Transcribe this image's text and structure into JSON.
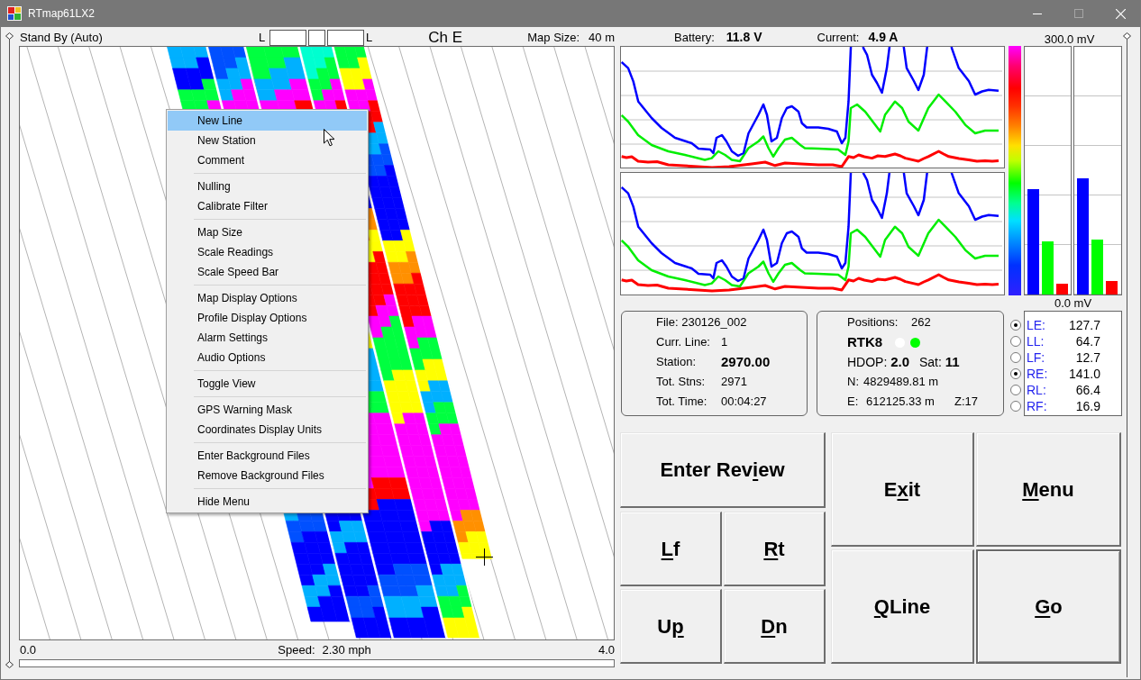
{
  "window": {
    "title": "RTmap61LX2",
    "maximize_enabled": false
  },
  "map_header": {
    "mode": "Stand By (Auto)",
    "left_marker": "L",
    "indicator_boxes": [
      {
        "kind": "wide"
      },
      {
        "kind": "narrow"
      },
      {
        "kind": "wide"
      }
    ],
    "right_marker": "L",
    "channel": "Ch E",
    "map_size_label": "Map Size:",
    "map_size": "40 m"
  },
  "context_menu": {
    "groups": [
      {
        "items": [
          {
            "label": "New Line",
            "selected": true
          },
          {
            "label": "New Station",
            "selected": false
          },
          {
            "label": "Comment",
            "selected": false
          }
        ]
      },
      {
        "items": [
          {
            "label": "Nulling",
            "selected": false
          },
          {
            "label": "Calibrate Filter",
            "selected": false
          }
        ]
      },
      {
        "items": [
          {
            "label": "Map Size",
            "selected": false
          },
          {
            "label": "Scale Readings",
            "selected": false
          },
          {
            "label": "Scale Speed Bar",
            "selected": false
          }
        ]
      },
      {
        "items": [
          {
            "label": "Map Display Options",
            "selected": false
          },
          {
            "label": "Profile Display Options",
            "selected": false
          },
          {
            "label": "Alarm Settings",
            "selected": false
          },
          {
            "label": "Audio Options",
            "selected": false
          }
        ]
      },
      {
        "items": [
          {
            "label": "Toggle View",
            "selected": false
          }
        ]
      },
      {
        "items": [
          {
            "label": "GPS Warning Mask",
            "selected": false
          },
          {
            "label": "Coordinates Display Units",
            "selected": false
          }
        ]
      },
      {
        "items": [
          {
            "label": "Enter Background Files",
            "selected": false
          },
          {
            "label": "Remove Background Files",
            "selected": false
          }
        ]
      },
      {
        "items": [
          {
            "label": "Hide Menu",
            "selected": false
          }
        ]
      }
    ]
  },
  "speed": {
    "min": "0.0",
    "label": "Speed:",
    "value": "2.30 mph",
    "max": "4.0"
  },
  "power": {
    "battery_label": "Battery:",
    "battery": "11.8 V",
    "current_label": "Current:",
    "current": "4.9 A"
  },
  "meters": {
    "max_label": "300.0 mV",
    "min_label": "0.0 mV",
    "groups": [
      {
        "bars": [
          {
            "level": 0.426,
            "color": "#0000ff"
          },
          {
            "level": 0.216,
            "color": "#00ff00"
          },
          {
            "level": 0.042,
            "color": "#ff0000"
          }
        ]
      },
      {
        "bars": [
          {
            "level": 0.47,
            "color": "#0000ff"
          },
          {
            "level": 0.221,
            "color": "#00ff00"
          },
          {
            "level": 0.056,
            "color": "#ff0000"
          }
        ]
      }
    ]
  },
  "file_panel": {
    "rows": [
      {
        "label": "File: 230126_002",
        "bold": false
      },
      {
        "label": "Curr. Line:",
        "value": "1",
        "bold": false
      },
      {
        "label": "Station:",
        "value": "2970.00",
        "bold": true
      },
      {
        "label": "Tot. Stns:",
        "value": "2971",
        "bold": false
      },
      {
        "label": "Tot. Time:",
        "value": "00:04:27",
        "bold": false
      }
    ]
  },
  "gps_panel": {
    "positions_label": "Positions:",
    "positions": "262",
    "fix": "RTK8",
    "status_dots": [
      {
        "color": "#ffffff"
      },
      {
        "color": "#00ff00"
      }
    ],
    "hdop": "HDOP: **2.0**",
    "sat": "Sat: **11**",
    "north_label": "N:",
    "north": "4829489.81 m",
    "east_label": "E:",
    "east": "612125.33 m",
    "zone": "Z:17"
  },
  "channels": [
    {
      "label": "LE:",
      "value": "127.7",
      "checked": true
    },
    {
      "label": "LL:",
      "value": "64.7",
      "checked": false
    },
    {
      "label": "LF:",
      "value": "12.7",
      "checked": false
    },
    {
      "label": "RE:",
      "value": "141.0",
      "checked": true
    },
    {
      "label": "RL:",
      "value": "66.4",
      "checked": false
    },
    {
      "label": "RF:",
      "value": "16.9",
      "checked": false
    }
  ],
  "buttons": {
    "enter_review": {
      "before": "Enter Rev",
      "mnemonic": "i",
      "after": "ew",
      "focused": false
    },
    "nudge": [
      {
        "mnemonic": "L",
        "after": "f",
        "focused": false
      },
      {
        "mnemonic": "R",
        "after": "t",
        "focused": false
      },
      {
        "before": "U",
        "mnemonic": "p",
        "focused": false
      },
      {
        "mnemonic": "D",
        "after": "n",
        "focused": false
      }
    ],
    "main": [
      {
        "before": "E",
        "mnemonic": "x",
        "after": "it",
        "focused": false
      },
      {
        "mnemonic": "M",
        "after": "enu",
        "focused": false
      },
      {
        "mnemonic": "Q",
        "after": "Line",
        "focused": false
      },
      {
        "mnemonic": "G",
        "after": "o",
        "focused": true
      }
    ]
  }
}
